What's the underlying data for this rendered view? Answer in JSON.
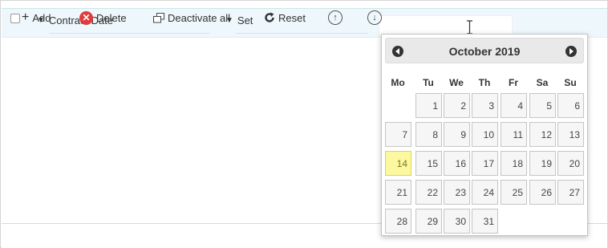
{
  "columns": {
    "contract_date": "Contract Date",
    "set": "Set"
  },
  "toolbar": {
    "add": "Add",
    "add_icon": "+",
    "delete": "Delete",
    "deactivate_all": "Deactivate all",
    "reset": "Reset"
  },
  "calendar": {
    "title": "October 2019",
    "weekdays": [
      "Mo",
      "Tu",
      "We",
      "Th",
      "Fr",
      "Sa",
      "Su"
    ],
    "days": [
      "1",
      "2",
      "3",
      "4",
      "5",
      "6",
      "7",
      "8",
      "9",
      "10",
      "11",
      "12",
      "13",
      "14",
      "15",
      "16",
      "17",
      "18",
      "19",
      "20",
      "21",
      "22",
      "23",
      "24",
      "25",
      "26",
      "27",
      "28",
      "29",
      "30",
      "31"
    ],
    "first_weekday_index": 1,
    "today": "14",
    "today_color": "#fcf8a0"
  },
  "colors": {
    "header_bg": "#eef7fb",
    "delete_icon": "#e23b3b"
  }
}
